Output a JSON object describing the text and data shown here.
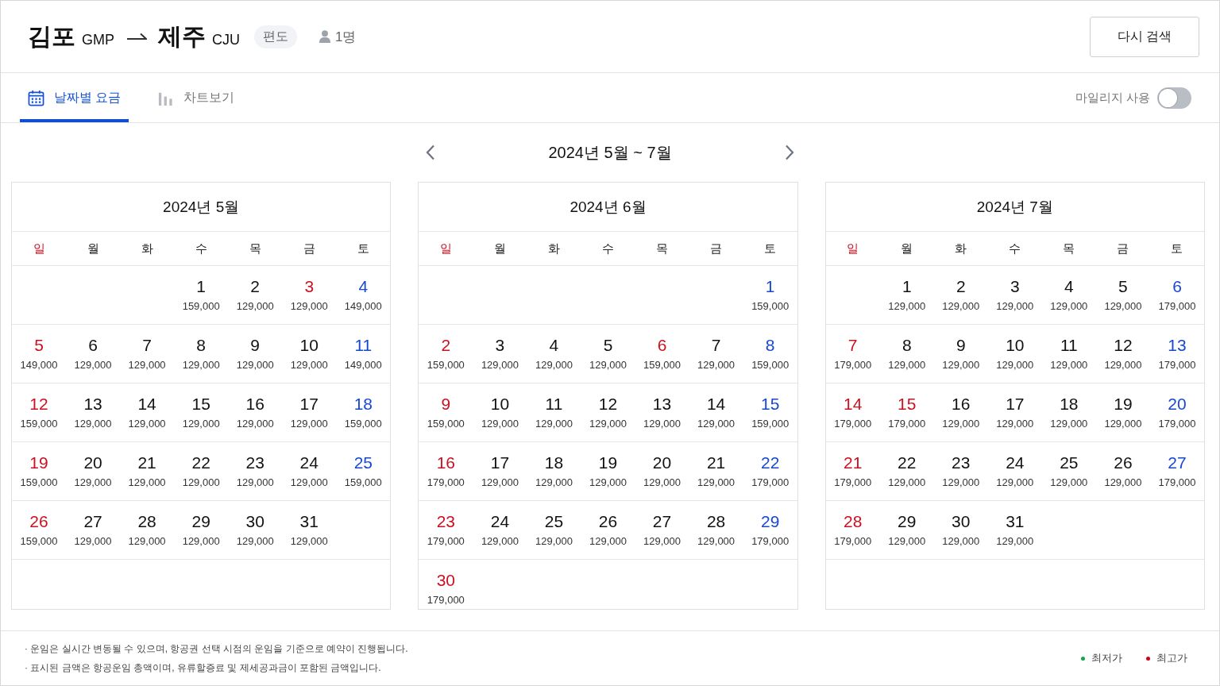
{
  "header": {
    "origin": {
      "city": "김포",
      "code": "GMP"
    },
    "destination": {
      "city": "제주",
      "code": "CJU"
    },
    "trip_type": "편도",
    "passengers": "1명",
    "search_again_button": "다시 검색"
  },
  "tabs": [
    {
      "label": "날짜별 요금",
      "selected": true
    },
    {
      "label": "차트보기",
      "selected": false
    }
  ],
  "mileage": {
    "label": "마일리지 사용",
    "on": false
  },
  "range_nav": {
    "title": "2024년 5월 ~ 7월"
  },
  "months": [
    {
      "title": "2024년 5월",
      "weekdays": [
        {
          "label": "일",
          "kind": "sunday"
        },
        {
          "label": "월",
          "kind": "weekday"
        },
        {
          "label": "화",
          "kind": "weekday"
        },
        {
          "label": "수",
          "kind": "weekday"
        },
        {
          "label": "목",
          "kind": "weekday"
        },
        {
          "label": "금",
          "kind": "weekday"
        },
        {
          "label": "토",
          "kind": "weekday"
        }
      ],
      "weeks": [
        {
          "kind": "first",
          "days": [
            {
              "day": "1",
              "price": "159,000",
              "kind": "weekday"
            },
            {
              "day": "2",
              "price": "129,000",
              "kind": "weekday"
            },
            {
              "day": "3",
              "price": "129,000",
              "kind": "holiday"
            },
            {
              "day": "4",
              "price": "149,000",
              "kind": "saturday"
            }
          ]
        },
        {
          "kind": "regular",
          "days": [
            {
              "day": "5",
              "price": "149,000",
              "kind": "holiday"
            },
            {
              "day": "6",
              "price": "129,000",
              "kind": "weekday"
            },
            {
              "day": "7",
              "price": "129,000",
              "kind": "weekday"
            },
            {
              "day": "8",
              "price": "129,000",
              "kind": "weekday"
            },
            {
              "day": "9",
              "price": "129,000",
              "kind": "weekday"
            },
            {
              "day": "10",
              "price": "129,000",
              "kind": "weekday"
            },
            {
              "day": "11",
              "price": "149,000",
              "kind": "saturday"
            }
          ]
        },
        {
          "kind": "regular",
          "days": [
            {
              "day": "12",
              "price": "159,000",
              "kind": "holiday"
            },
            {
              "day": "13",
              "price": "129,000",
              "kind": "weekday"
            },
            {
              "day": "14",
              "price": "129,000",
              "kind": "weekday"
            },
            {
              "day": "15",
              "price": "129,000",
              "kind": "weekday"
            },
            {
              "day": "16",
              "price": "129,000",
              "kind": "weekday"
            },
            {
              "day": "17",
              "price": "129,000",
              "kind": "weekday"
            },
            {
              "day": "18",
              "price": "159,000",
              "kind": "saturday"
            }
          ]
        },
        {
          "kind": "regular",
          "days": [
            {
              "day": "19",
              "price": "159,000",
              "kind": "holiday"
            },
            {
              "day": "20",
              "price": "129,000",
              "kind": "weekday"
            },
            {
              "day": "21",
              "price": "129,000",
              "kind": "weekday"
            },
            {
              "day": "22",
              "price": "129,000",
              "kind": "weekday"
            },
            {
              "day": "23",
              "price": "129,000",
              "kind": "weekday"
            },
            {
              "day": "24",
              "price": "129,000",
              "kind": "weekday"
            },
            {
              "day": "25",
              "price": "159,000",
              "kind": "saturday"
            }
          ]
        },
        {
          "kind": "regular",
          "days": [
            {
              "day": "26",
              "price": "159,000",
              "kind": "holiday"
            },
            {
              "day": "27",
              "price": "129,000",
              "kind": "weekday"
            },
            {
              "day": "28",
              "price": "129,000",
              "kind": "weekday"
            },
            {
              "day": "29",
              "price": "129,000",
              "kind": "weekday"
            },
            {
              "day": "30",
              "price": "129,000",
              "kind": "weekday"
            },
            {
              "day": "31",
              "price": "129,000",
              "kind": "weekday"
            }
          ]
        }
      ]
    },
    {
      "title": "2024년 6월",
      "weekdays": [
        {
          "label": "일",
          "kind": "sunday"
        },
        {
          "label": "월",
          "kind": "weekday"
        },
        {
          "label": "화",
          "kind": "weekday"
        },
        {
          "label": "수",
          "kind": "weekday"
        },
        {
          "label": "목",
          "kind": "weekday"
        },
        {
          "label": "금",
          "kind": "weekday"
        },
        {
          "label": "토",
          "kind": "weekday"
        }
      ],
      "weeks": [
        {
          "kind": "first",
          "days": [
            {
              "day": "1",
              "price": "159,000",
              "kind": "saturday"
            }
          ]
        },
        {
          "kind": "regular",
          "days": [
            {
              "day": "2",
              "price": "159,000",
              "kind": "holiday"
            },
            {
              "day": "3",
              "price": "129,000",
              "kind": "weekday"
            },
            {
              "day": "4",
              "price": "129,000",
              "kind": "weekday"
            },
            {
              "day": "5",
              "price": "129,000",
              "kind": "weekday"
            },
            {
              "day": "6",
              "price": "159,000",
              "kind": "holiday"
            },
            {
              "day": "7",
              "price": "129,000",
              "kind": "weekday"
            },
            {
              "day": "8",
              "price": "159,000",
              "kind": "saturday"
            }
          ]
        },
        {
          "kind": "regular",
          "days": [
            {
              "day": "9",
              "price": "159,000",
              "kind": "holiday"
            },
            {
              "day": "10",
              "price": "129,000",
              "kind": "weekday"
            },
            {
              "day": "11",
              "price": "129,000",
              "kind": "weekday"
            },
            {
              "day": "12",
              "price": "129,000",
              "kind": "weekday"
            },
            {
              "day": "13",
              "price": "129,000",
              "kind": "weekday"
            },
            {
              "day": "14",
              "price": "129,000",
              "kind": "weekday"
            },
            {
              "day": "15",
              "price": "159,000",
              "kind": "saturday"
            }
          ]
        },
        {
          "kind": "regular",
          "days": [
            {
              "day": "16",
              "price": "179,000",
              "kind": "holiday"
            },
            {
              "day": "17",
              "price": "129,000",
              "kind": "weekday"
            },
            {
              "day": "18",
              "price": "129,000",
              "kind": "weekday"
            },
            {
              "day": "19",
              "price": "129,000",
              "kind": "weekday"
            },
            {
              "day": "20",
              "price": "129,000",
              "kind": "weekday"
            },
            {
              "day": "21",
              "price": "129,000",
              "kind": "weekday"
            },
            {
              "day": "22",
              "price": "179,000",
              "kind": "saturday"
            }
          ]
        },
        {
          "kind": "regular",
          "days": [
            {
              "day": "23",
              "price": "179,000",
              "kind": "holiday"
            },
            {
              "day": "24",
              "price": "129,000",
              "kind": "weekday"
            },
            {
              "day": "25",
              "price": "129,000",
              "kind": "weekday"
            },
            {
              "day": "26",
              "price": "129,000",
              "kind": "weekday"
            },
            {
              "day": "27",
              "price": "129,000",
              "kind": "weekday"
            },
            {
              "day": "28",
              "price": "129,000",
              "kind": "weekday"
            },
            {
              "day": "29",
              "price": "179,000",
              "kind": "saturday"
            }
          ]
        },
        {
          "kind": "regular",
          "days": [
            {
              "day": "30",
              "price": "179,000",
              "kind": "holiday"
            }
          ]
        }
      ]
    },
    {
      "title": "2024년 7월",
      "weekdays": [
        {
          "label": "일",
          "kind": "sunday"
        },
        {
          "label": "월",
          "kind": "weekday"
        },
        {
          "label": "화",
          "kind": "weekday"
        },
        {
          "label": "수",
          "kind": "weekday"
        },
        {
          "label": "목",
          "kind": "weekday"
        },
        {
          "label": "금",
          "kind": "weekday"
        },
        {
          "label": "토",
          "kind": "weekday"
        }
      ],
      "weeks": [
        {
          "kind": "first",
          "days": [
            {
              "day": "1",
              "price": "129,000",
              "kind": "weekday"
            },
            {
              "day": "2",
              "price": "129,000",
              "kind": "weekday"
            },
            {
              "day": "3",
              "price": "129,000",
              "kind": "weekday"
            },
            {
              "day": "4",
              "price": "129,000",
              "kind": "weekday"
            },
            {
              "day": "5",
              "price": "129,000",
              "kind": "weekday"
            },
            {
              "day": "6",
              "price": "179,000",
              "kind": "saturday"
            }
          ]
        },
        {
          "kind": "regular",
          "days": [
            {
              "day": "7",
              "price": "179,000",
              "kind": "holiday"
            },
            {
              "day": "8",
              "price": "129,000",
              "kind": "weekday"
            },
            {
              "day": "9",
              "price": "129,000",
              "kind": "weekday"
            },
            {
              "day": "10",
              "price": "129,000",
              "kind": "weekday"
            },
            {
              "day": "11",
              "price": "129,000",
              "kind": "weekday"
            },
            {
              "day": "12",
              "price": "129,000",
              "kind": "weekday"
            },
            {
              "day": "13",
              "price": "179,000",
              "kind": "saturday"
            }
          ]
        },
        {
          "kind": "regular",
          "days": [
            {
              "day": "14",
              "price": "179,000",
              "kind": "holiday"
            },
            {
              "day": "15",
              "price": "179,000",
              "kind": "holiday"
            },
            {
              "day": "16",
              "price": "129,000",
              "kind": "weekday"
            },
            {
              "day": "17",
              "price": "129,000",
              "kind": "weekday"
            },
            {
              "day": "18",
              "price": "129,000",
              "kind": "weekday"
            },
            {
              "day": "19",
              "price": "129,000",
              "kind": "weekday"
            },
            {
              "day": "20",
              "price": "179,000",
              "kind": "saturday"
            }
          ]
        },
        {
          "kind": "regular",
          "days": [
            {
              "day": "21",
              "price": "179,000",
              "kind": "holiday"
            },
            {
              "day": "22",
              "price": "129,000",
              "kind": "weekday"
            },
            {
              "day": "23",
              "price": "129,000",
              "kind": "weekday"
            },
            {
              "day": "24",
              "price": "129,000",
              "kind": "weekday"
            },
            {
              "day": "25",
              "price": "129,000",
              "kind": "weekday"
            },
            {
              "day": "26",
              "price": "129,000",
              "kind": "weekday"
            },
            {
              "day": "27",
              "price": "179,000",
              "kind": "saturday"
            }
          ]
        },
        {
          "kind": "regular",
          "days": [
            {
              "day": "28",
              "price": "179,000",
              "kind": "holiday"
            },
            {
              "day": "29",
              "price": "129,000",
              "kind": "weekday"
            },
            {
              "day": "30",
              "price": "129,000",
              "kind": "weekday"
            },
            {
              "day": "31",
              "price": "129,000",
              "kind": "weekday"
            }
          ]
        }
      ]
    }
  ],
  "notes": [
    "· 운임은 실시간 변동될 수 있으며, 항공권 선택 시점의 운임을 기준으로 예약이 진행됩니다.",
    "· 표시된 금액은 항공운임 총액이며, 유류할증료 및 제세공과금이 포함된 금액입니다."
  ],
  "legend": [
    {
      "label": "최저가",
      "color": "#16a34a"
    },
    {
      "label": "최고가",
      "color": "#d0021b"
    }
  ]
}
